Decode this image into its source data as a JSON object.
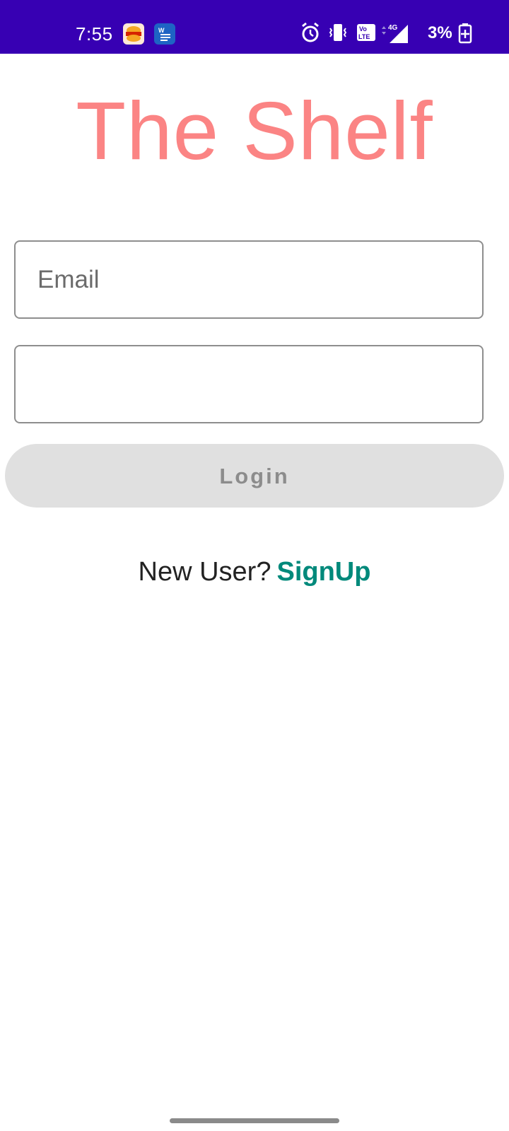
{
  "status_bar": {
    "time": "7:55",
    "battery": "3%",
    "notification_icons": [
      "burger-king-icon",
      "word-doc-icon"
    ],
    "system_icons": [
      "alarm-icon",
      "vibrate-icon",
      "volte-icon",
      "signal-4g-icon",
      "battery-icon"
    ],
    "background_color": "#3700b3"
  },
  "app": {
    "title": "The Shelf",
    "title_color": "#fb8484"
  },
  "login_form": {
    "email_placeholder": "Email",
    "password_placeholder": "",
    "login_label": "Login"
  },
  "signup": {
    "prompt": "New User?",
    "link_label": "SignUp",
    "link_color": "#00897b"
  }
}
